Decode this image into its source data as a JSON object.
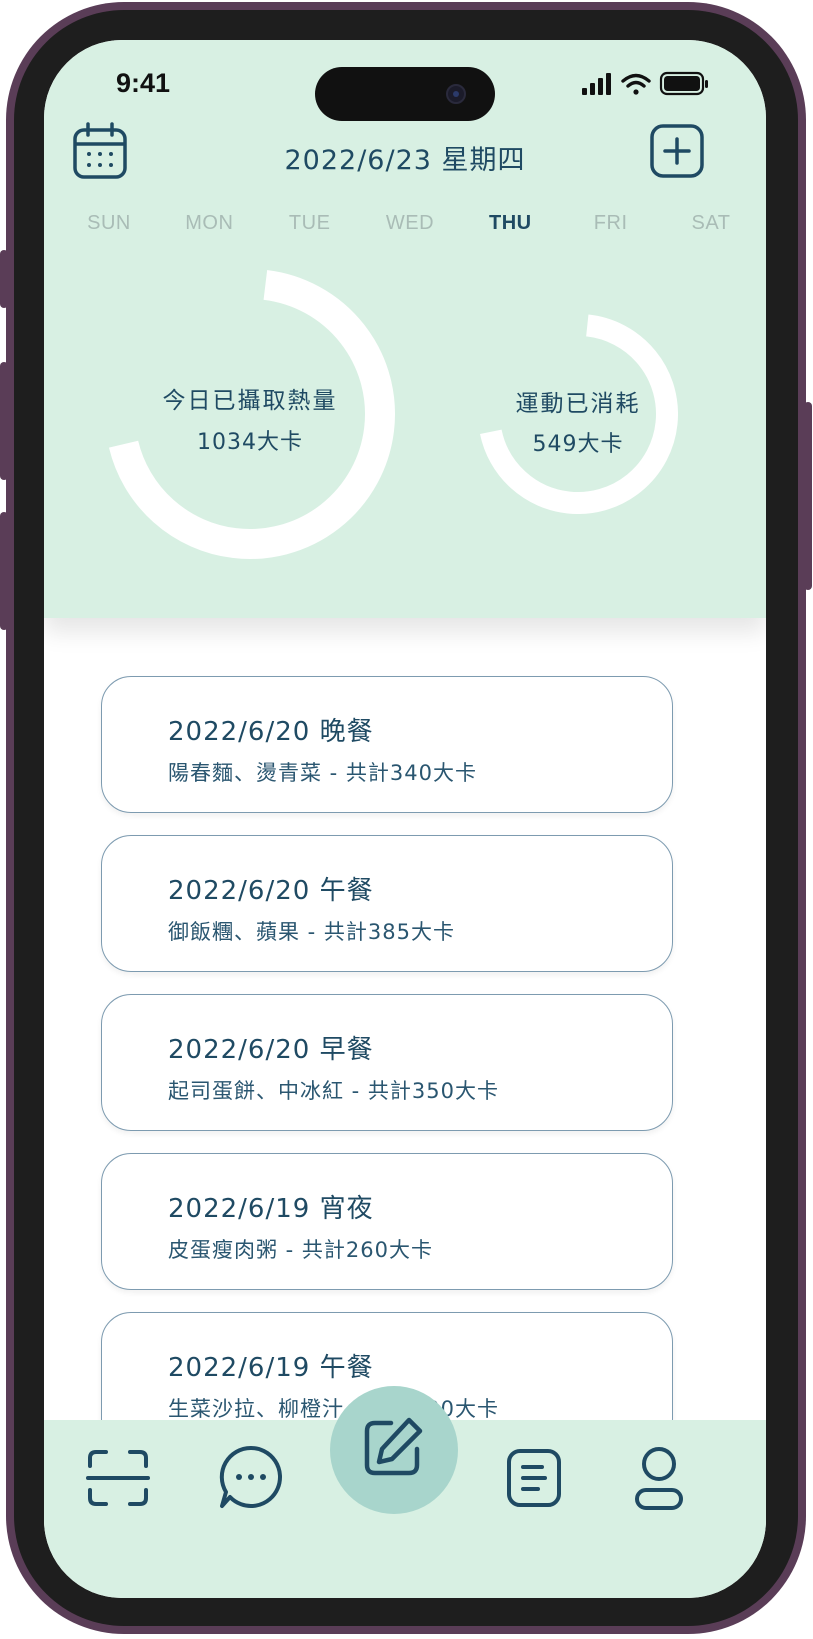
{
  "status_bar": {
    "time": "9:41"
  },
  "header": {
    "date_title": "2022/6/23 星期四"
  },
  "weekdays": [
    {
      "label": "SUN",
      "active": false
    },
    {
      "label": "MON",
      "active": false
    },
    {
      "label": "TUE",
      "active": false
    },
    {
      "label": "WED",
      "active": false
    },
    {
      "label": "THU",
      "active": true
    },
    {
      "label": "FRI",
      "active": false
    },
    {
      "label": "SAT",
      "active": false
    }
  ],
  "summary": {
    "intake": {
      "label": "今日已攝取熱量",
      "value": "1034大卡"
    },
    "burned": {
      "label": "運動已消耗",
      "value": "549大卡"
    }
  },
  "meals": [
    {
      "title": "2022/6/20 晚餐",
      "desc": "陽春麵、燙青菜 - 共計340大卡"
    },
    {
      "title": "2022/6/20 午餐",
      "desc": "御飯糰、蘋果 - 共計385大卡"
    },
    {
      "title": "2022/6/20 早餐",
      "desc": "起司蛋餅、中冰紅 - 共計350大卡"
    },
    {
      "title": "2022/6/19 宵夜",
      "desc": "皮蛋瘦肉粥 - 共計260大卡"
    },
    {
      "title": "2022/6/19 午餐",
      "desc": "生菜沙拉、柳橙汁 - 共計100大卡"
    }
  ],
  "colors": {
    "header_bg": "#d8f0e3",
    "accent": "#1f4a63",
    "fab": "#a8d5cc",
    "frame": "#5a3d57"
  },
  "icons": {
    "calendar": "calendar-icon",
    "add": "plus-square-icon",
    "scan": "scan-icon",
    "chat": "chat-bubble-icon",
    "edit": "edit-icon",
    "notes": "notes-icon",
    "profile": "user-icon"
  }
}
